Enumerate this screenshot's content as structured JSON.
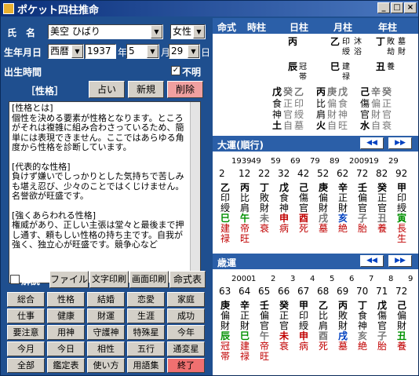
{
  "title": "ポケット四柱推命",
  "window_buttons": [
    "_",
    "□",
    "×"
  ],
  "form": {
    "name_label": "氏　名",
    "name_value": "美空 ひばり",
    "gender_value": "女性",
    "birth_label": "生年月日",
    "era_value": "西暦",
    "year_value": "1937",
    "year_unit": "年",
    "month_value": "5",
    "month_unit": "月",
    "day_value": "29",
    "day_unit": "日",
    "birthtime_label": "出生時間",
    "unknown_label": "不明"
  },
  "section_label": "［性格］",
  "top_buttons": [
    "占い",
    "新規",
    "削除"
  ],
  "text_lines": [
    "[性格とは]",
    "個性を決める要素が性格となります。ところがそれは複雑に組み合わさっているため、簡単には表現できません。ここではあらゆる角度から性格を診断しています。",
    "",
    "[代表的な性格]",
    "負けず嫌いでしっかりとした気持ちで苦しみも堪え忍び、少々のことではくじけません。名誉欲が旺盛です。",
    "",
    "[強くあらわれる性格]",
    "権威があり、正しい主張は堂々と最後まで押し通す、頼もしい性格の持ち主です。自我が強く、独立心が旺盛です。競争心など"
  ],
  "explain_label": "解説",
  "tool_buttons": [
    "ファイル",
    "文字印刷",
    "画面印刷",
    "命式表"
  ],
  "grid_buttons": [
    "総合",
    "性格",
    "結婚",
    "恋愛",
    "家庭",
    "仕事",
    "健康",
    "財運",
    "生涯",
    "成功",
    "要注意",
    "用神",
    "守護神",
    "特殊星",
    "今年",
    "今月",
    "今日",
    "相性",
    "五行",
    "通変星",
    "全部",
    "鑑定表",
    "使い方",
    "用語集",
    "終了"
  ],
  "meishiki": {
    "header": [
      "命式",
      "時柱",
      "日柱",
      "月柱",
      "年柱"
    ],
    "row1": {
      "day": "丙",
      "month": "乙",
      "month_sub": "印",
      "month_sub2": "沐",
      "month_sub3": "綬",
      "month_sub4": "浴",
      "year": "丁",
      "year_sub": "敗",
      "year_sub2": "劫",
      "year_sub3": "墓",
      "year_sub4": "財"
    },
    "row2": {
      "day": "辰",
      "day_sub": "冠",
      "day_sub2": "帯",
      "month": "巳",
      "month_sub": "建",
      "month_sub2": "禄",
      "year": "丑",
      "year_sub": "養"
    },
    "row3": {
      "c1": "戊",
      "c1b": "癸",
      "c1c": "乙",
      "c2": "丙",
      "c2b": "庚",
      "c2c": "戊",
      "c3": "己",
      "c3b": "辛",
      "c3c": "癸"
    },
    "row4": [
      "食",
      "正",
      "印",
      "比",
      "偏",
      "食",
      "傷",
      "偏",
      "正"
    ],
    "row5": [
      "神",
      "官",
      "綬",
      "肩",
      "財",
      "神",
      "官",
      "財",
      "官"
    ],
    "row6": [
      "土",
      "自",
      "墓",
      "火",
      "自",
      "旺",
      "水",
      "自",
      "衰"
    ]
  },
  "taiun": {
    "title": "大運(順行)",
    "years": [
      "1939",
      "49",
      "59",
      "69",
      "79",
      "89",
      "2009",
      "19",
      "29"
    ],
    "ages": [
      "2",
      "12",
      "22",
      "32",
      "42",
      "52",
      "62",
      "72",
      "82",
      "92"
    ],
    "stems": [
      "乙",
      "丙",
      "丁",
      "戊",
      "己",
      "庚",
      "辛",
      "壬",
      "癸",
      "甲"
    ],
    "r2": [
      "印",
      "比",
      "敗",
      "食",
      "傷",
      "偏",
      "正",
      "偏",
      "正",
      "印"
    ],
    "r3": [
      "綬",
      "肩",
      "財",
      "神",
      "官",
      "財",
      "財",
      "官",
      "官",
      "綬"
    ],
    "branches": [
      "巳",
      "午",
      "未",
      "申",
      "酉",
      "戌",
      "亥",
      "子",
      "丑",
      "寅"
    ],
    "r5": [
      "建",
      "帝",
      "衰",
      "病",
      "死",
      "墓",
      "絶",
      "胎",
      "養",
      "長"
    ],
    "r6": [
      "禄",
      "旺",
      "",
      "",
      "",
      "",
      "",
      "",
      "",
      "生"
    ]
  },
  "saiun": {
    "title": "歳運",
    "years": [
      "2000",
      "1",
      "2",
      "3",
      "4",
      "5",
      "6",
      "7",
      "8",
      "9"
    ],
    "ages": [
      "63",
      "64",
      "65",
      "66",
      "67",
      "68",
      "69",
      "70",
      "71",
      "72"
    ],
    "stems": [
      "庚",
      "辛",
      "壬",
      "癸",
      "甲",
      "乙",
      "丙",
      "丁",
      "戊",
      "己"
    ],
    "r2": [
      "偏",
      "正",
      "偏",
      "正",
      "印",
      "比",
      "敗",
      "食",
      "傷",
      "偏"
    ],
    "r3": [
      "財",
      "財",
      "官",
      "官",
      "綬",
      "肩",
      "財",
      "神",
      "官",
      "財"
    ],
    "branches": [
      "辰",
      "巳",
      "午",
      "未",
      "申",
      "酉",
      "戌",
      "亥",
      "子",
      "丑"
    ],
    "r5": [
      "冠",
      "建",
      "帝",
      "衰",
      "病",
      "死",
      "墓",
      "絶",
      "胎",
      "養"
    ],
    "r6": [
      "帯",
      "禄",
      "旺",
      "",
      "",
      "",
      "",
      "",
      "",
      ""
    ]
  },
  "nav": {
    "prev": "◀◀",
    "next": "▶▶"
  }
}
